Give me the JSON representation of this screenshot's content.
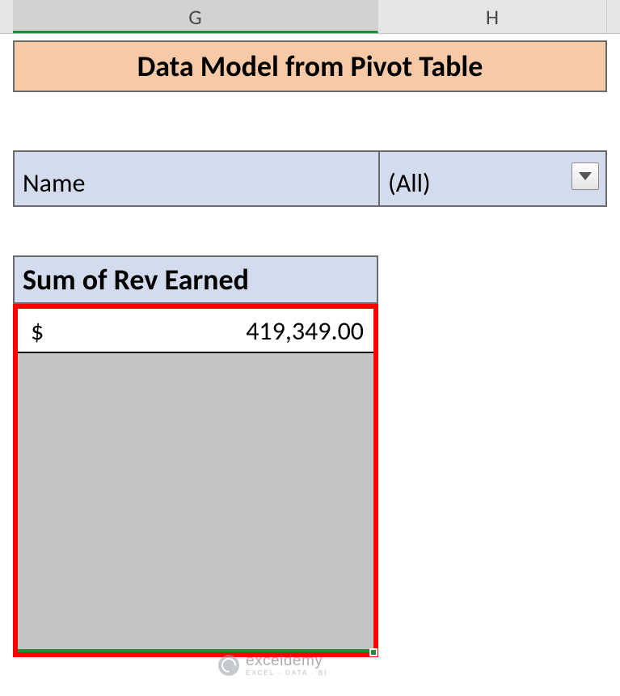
{
  "columns": {
    "g": "G",
    "h": "H"
  },
  "title": "Data Model from Pivot Table",
  "filter": {
    "label": "Name",
    "value": "(All)"
  },
  "pivot": {
    "header": "Sum of Rev Earned",
    "currency_symbol": "$",
    "value": "419,349.00"
  },
  "watermark": {
    "brand": "exceldemy",
    "tag": "EXCEL · DATA · BI"
  }
}
